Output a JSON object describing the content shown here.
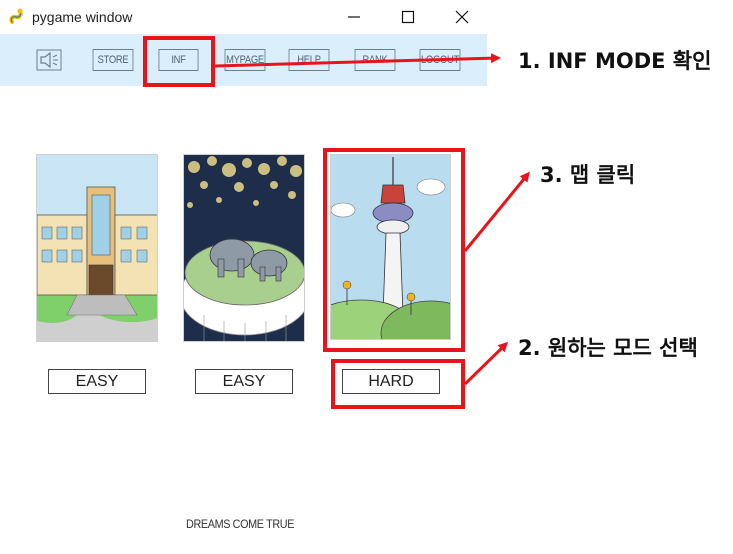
{
  "window": {
    "title": "pygame window",
    "icon": "pygame-snake-icon",
    "controls": [
      "minimize-icon",
      "maximize-icon",
      "close-icon"
    ]
  },
  "toolbar": {
    "sound_icon": "speaker-mute-icon",
    "buttons": [
      "STORE",
      "INF",
      "MYPAGE",
      "HELP",
      "RANK",
      "LOGOUT"
    ]
  },
  "maps": [
    {
      "image": "school-building",
      "mode": "EASY"
    },
    {
      "image": "zoo-elephants",
      "mode": "EASY"
    },
    {
      "image": "seoul-tower",
      "mode": "HARD"
    }
  ],
  "footer": "DREAMS COME TRUE",
  "annotations": {
    "step1": "1. INF MODE 확인",
    "step2": "2. 원하는 모드 선택",
    "step3": "3. 맵 클릭",
    "color": "#e8141b"
  }
}
